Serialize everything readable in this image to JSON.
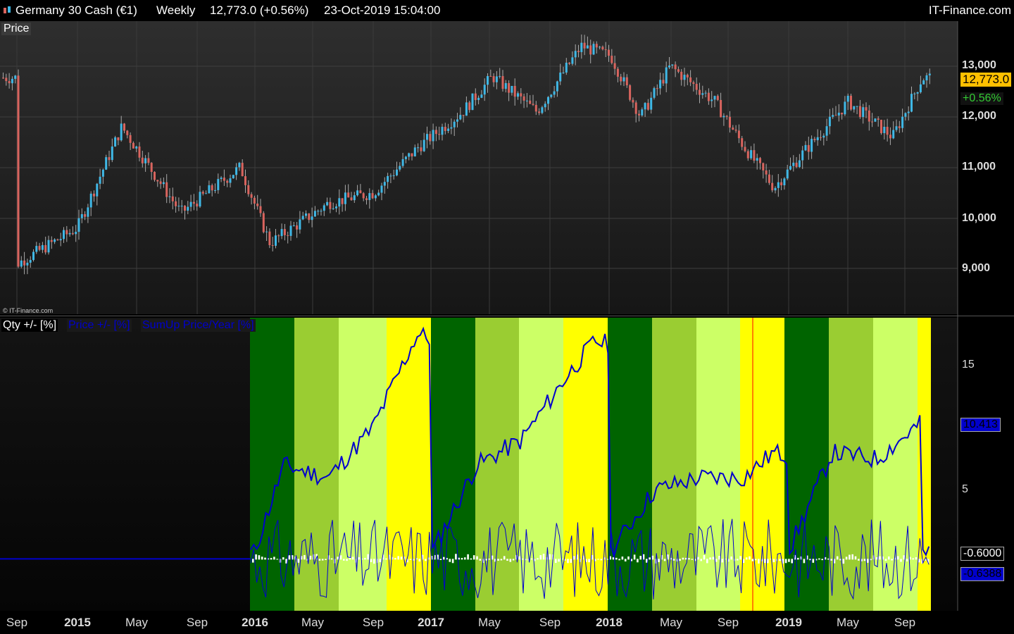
{
  "header": {
    "instrument": "Germany 30 Cash (€1)",
    "timeframe": "Weekly",
    "quote": "12,773.0 (+0.56%)",
    "datetime": "23-Oct-2019 15:04:00",
    "brand": "IT-Finance.com"
  },
  "price_panel": {
    "label": "Price",
    "watermark": "© IT-Finance.com",
    "y_ticks": [
      "13,000",
      "12,000",
      "11,000",
      "10,000",
      "9,000"
    ],
    "last_price": "12,773.0",
    "change": "+0.56%"
  },
  "indicator_panel": {
    "labels": [
      "Qty +/- [%]",
      "Price +/- [%]",
      "SumUp Price/Year [%]"
    ],
    "y_ticks": [
      "15",
      "5"
    ],
    "value_sumup": "10.413",
    "value_qty": "-0.6000",
    "value_price": "-0.6388"
  },
  "x_axis": [
    "Sep",
    "2015",
    "May",
    "Sep",
    "2016",
    "May",
    "Sep",
    "2017",
    "May",
    "Sep",
    "2018",
    "May",
    "Sep",
    "2019",
    "May",
    "Sep"
  ],
  "colors": {
    "up_candle": "#3fb8e6",
    "down_candle": "#d9645e",
    "q1": "#006400",
    "q2": "#9acd32",
    "q3": "#ccff66",
    "q4": "#ffff00",
    "line": "#0000cc"
  },
  "chart_data": [
    {
      "type": "line",
      "title": "Germany 30 Cash (€1) Weekly",
      "ylabel": "Price",
      "ylim": [
        8200,
        13700
      ],
      "x": [
        "2014-09",
        "2015-01",
        "2015-04",
        "2015-08",
        "2015-12",
        "2016-02",
        "2016-06",
        "2016-09",
        "2016-12",
        "2017-03",
        "2017-05",
        "2017-08",
        "2017-11",
        "2018-01",
        "2018-03",
        "2018-05",
        "2018-08",
        "2018-10",
        "2018-12",
        "2019-02",
        "2019-05",
        "2019-08",
        "2019-10"
      ],
      "series": [
        {
          "values": [
            9100,
            9800,
            11800,
            10100,
            11000,
            9500,
            10300,
            10500,
            11400,
            12100,
            12800,
            12100,
            13400,
            13200,
            12000,
            13000,
            12300,
            11400,
            10600,
            11300,
            12300,
            11600,
            12773
          ]
        }
      ]
    },
    {
      "type": "line",
      "ylim": [
        -4,
        20
      ],
      "x": [
        "2016-01",
        "2016-03",
        "2016-06",
        "2016-09",
        "2016-12",
        "2017-01",
        "2017-04",
        "2017-07",
        "2017-10",
        "2017-12",
        "2018-01",
        "2018-04",
        "2018-07",
        "2018-10",
        "2018-12",
        "2019-01",
        "2019-04",
        "2019-07",
        "2019-10"
      ],
      "series": [
        {
          "name": "SumUp Price/Year [%]",
          "values": [
            0,
            7,
            6,
            10,
            17.5,
            0,
            7,
            9,
            14,
            17,
            0,
            5,
            6,
            6,
            8,
            0,
            8,
            7.5,
            10.413
          ]
        },
        {
          "name": "Qty +/- [%]",
          "values": [
            0,
            0.6,
            -0.6,
            0.4,
            -0.5,
            0.6,
            0.8,
            -0.4,
            0.3,
            -0.6,
            0.5,
            -0.3,
            0.4,
            -0.6,
            0.2,
            0.7,
            -0.5,
            0.4,
            -0.6
          ]
        },
        {
          "name": "Price +/- [%]",
          "values": [
            0,
            2,
            -2,
            1.5,
            -2,
            2,
            -1.5,
            1.8,
            -2.5,
            2,
            -2,
            1.5,
            -1.8,
            2,
            -2.5,
            1.5,
            -2,
            1.5,
            -0.6388
          ]
        }
      ]
    }
  ]
}
